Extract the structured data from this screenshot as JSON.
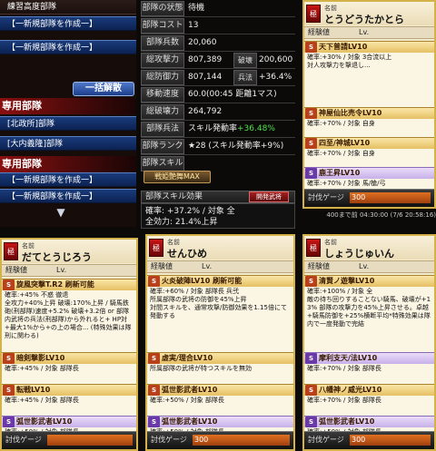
{
  "left": {
    "rows_top": [
      "練習高度部隊",
      "【一新規部隊を作成一】",
      "【一新規部隊を作成一】"
    ],
    "button_release": "一括解散",
    "section2_title": "専用部隊",
    "section2_rows": [
      "[北政所]部隊",
      "[大内義隆]部隊"
    ],
    "section3_title": "専用部隊",
    "section3_rows": [
      "【一新規部隊を作成一】",
      "【一新規部隊を作成一】"
    ],
    "arrow_icon": "down-triangle-icon"
  },
  "center": {
    "rows": [
      {
        "label": "部隊の状態",
        "value": "待機"
      },
      {
        "label": "部隊コスト",
        "value": "13"
      },
      {
        "label": "部隊兵数",
        "value": "20,060"
      },
      {
        "label": "総攻撃力",
        "value": "807,389",
        "label2": "破壊",
        "value2": "200,600"
      },
      {
        "label": "総防御力",
        "value": "807,144",
        "label2": "兵法",
        "value2": "+36.4%"
      },
      {
        "label": "移動速度",
        "value": "60.0(00:45 距離1マス)"
      },
      {
        "label": "総破壊力",
        "value": "264,792"
      },
      {
        "label": "部隊兵法",
        "value": "スキル発動率",
        "value_hl": "+36.48%"
      },
      {
        "label": "部隊ランク",
        "value": "★28 (スキル発動率+9%)"
      },
      {
        "label": "部隊スキル",
        "value": ""
      }
    ],
    "skill_button": "戦姫艶舞MAX",
    "effect_header": "部隊スキル効果",
    "kaihatsu_badge": "開発武将",
    "effect_lines": [
      "確率: +37.2% / 対象 全",
      "全効力: 21.4%上昇"
    ]
  },
  "cards": [
    {
      "name_label": "名前",
      "name": "だてとうじろう",
      "exp_label": "経験値",
      "lv_label": "Lv.",
      "skills": [
        {
          "rank": "S",
          "title": "旋風突撃T.R2 刷新可能",
          "purple": false,
          "desc": "確率:+45% 不惑 徹退\n全攻力+40%上昇 破壊:170%上昇 / 騎馬鉄砲(刑部隊)速度+5.2% 破壊+3.2倍 or 部隊内武将の兵法(刑部隊)から外れると+ HP対+最大1%から+の上の場合... (特殊効果は隊刑に関わる)"
        },
        {
          "rank": "S",
          "title": "暗剣撃影LV10",
          "purple": false,
          "desc": "確率:+45% / 対象 部隊長"
        },
        {
          "rank": "S",
          "title": "転戦LV10",
          "purple": false,
          "desc": "確率:+45% / 対象 部隊長"
        },
        {
          "rank": "S",
          "title": "弧世影武者LV10",
          "purple": true,
          "desc": "確率:+50% / 対象 部隊長"
        }
      ],
      "foot_label": "討伐ゲージ",
      "foot_value": ""
    },
    {
      "name_label": "名前",
      "name": "せんひめ",
      "exp_label": "経験値",
      "lv_label": "Lv.",
      "skills": [
        {
          "rank": "S",
          "title": "火炎破陣LV10 刷新可能",
          "purple": false,
          "desc": "確率:+60% / 対象 部隊長 兵弐\n所属部隊の武将の防御を45%上昇\n対間スキルを、通常攻撃/防御効果を1.15倍にて発動する"
        },
        {
          "rank": "S",
          "title": "虚実/理合LV10",
          "purple": false,
          "desc": "所属部隊の武将が特つスキルを無効"
        },
        {
          "rank": "S",
          "title": "弧世影武者LV10",
          "purple": false,
          "desc": "確率:+50% / 対象 部隊長"
        },
        {
          "rank": "S",
          "title": "弧世影武者LV10",
          "purple": true,
          "desc": "確率:+50% / 対象 部隊長"
        }
      ],
      "foot_label": "討伐ゲージ",
      "foot_value": "300"
    },
    {
      "name_label": "名前",
      "name": "しょうじゅいん",
      "exp_label": "経験値",
      "lv_label": "Lv.",
      "skills": [
        {
          "rank": "S",
          "title": "清賢ノ遊撃LV10",
          "purple": false,
          "desc": "確率:+100% / 対象 全\n敵の待ち回りすることない騎馬、破壊が+13% 部隊の攻撃力を45%上昇させる。卓越+騎馬防御を+25%横断平均*特殊効果は隊内で一度発動で完結"
        },
        {
          "rank": "S",
          "title": "摩利支天/法LV10",
          "purple": true,
          "desc": "確率:+70% / 対象 部隊長"
        },
        {
          "rank": "S",
          "title": "八幡神ノ威光LV10",
          "purple": false,
          "desc": "確率:+70% / 対象 部隊長"
        },
        {
          "rank": "S",
          "title": "弧世影武者LV10",
          "purple": true,
          "desc": "確率:+50% / 対象 部隊長"
        }
      ],
      "foot_label": "討伐ゲージ",
      "foot_value": "300"
    }
  ],
  "topcard": {
    "name_label": "名前",
    "name": "とうどうたかとら",
    "exp_label": "経験値",
    "lv_label": "Lv.",
    "skills": [
      {
        "rank": "S",
        "title": "天下普請LV10",
        "purple": false,
        "desc": "確率:+30% / 対象 3合流以上\n対人攻撃力を撃退し..."
      },
      {
        "rank": "S",
        "title": "神屋仙比売令LV10",
        "purple": false,
        "desc": "確率:+70% / 対象 自身"
      },
      {
        "rank": "S",
        "title": "四至/神城LV10",
        "purple": false,
        "desc": "確率:+70% / 対象 自身"
      },
      {
        "rank": "S",
        "title": "鹿王昇LV10",
        "purple": true,
        "desc": "確率:+70% / 対象 馬/槍/弓"
      }
    ],
    "foot_label": "討伐ゲージ",
    "foot_value": "300",
    "note": "400まで前 04:30:00 (7/6 20:58:16)"
  }
}
